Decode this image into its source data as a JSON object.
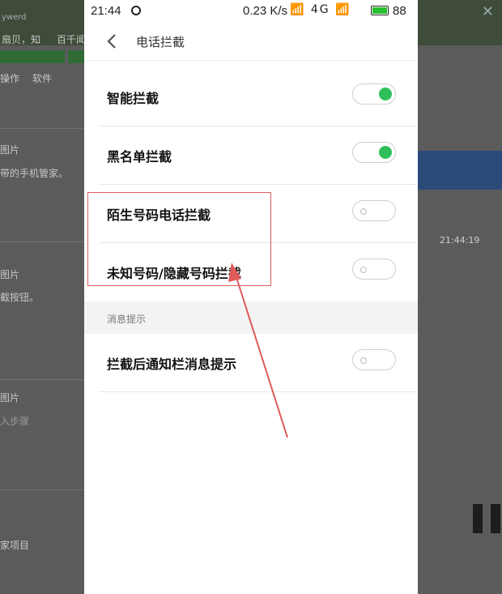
{
  "background": {
    "top_left_text": "ywerd",
    "snippet_1": "扇贝，知",
    "snippet_2": "百千闻",
    "menu_1": "操作",
    "menu_2": "软件",
    "label_1": "图片",
    "desc_1": "带的手机管家。",
    "label_2": "图片",
    "desc_2": "截按钮。",
    "label_3": "图片",
    "desc_3": "入步骤",
    "bottom_text": "家项目",
    "timestamp": "21:44:19"
  },
  "status_bar": {
    "time": "21:44",
    "network_speed": "0.23 K/s",
    "signal_icons": "📶 4G 📶",
    "battery_level": "88",
    "battery_color": "#28c030"
  },
  "header": {
    "title": "电话拦截"
  },
  "settings": [
    {
      "label": "智能拦截",
      "enabled": true
    },
    {
      "label": "黑名单拦截",
      "enabled": true
    },
    {
      "label": "陌生号码电话拦截",
      "enabled": false
    },
    {
      "label": "未知号码/隐藏号码拦截",
      "enabled": false
    }
  ],
  "section": {
    "title": "消息提示"
  },
  "notification_setting": {
    "label": "拦截后通知栏消息提示",
    "enabled": false
  },
  "colors": {
    "toggle_on": "#2fbf5a",
    "annotation_red": "#e05a5a"
  }
}
